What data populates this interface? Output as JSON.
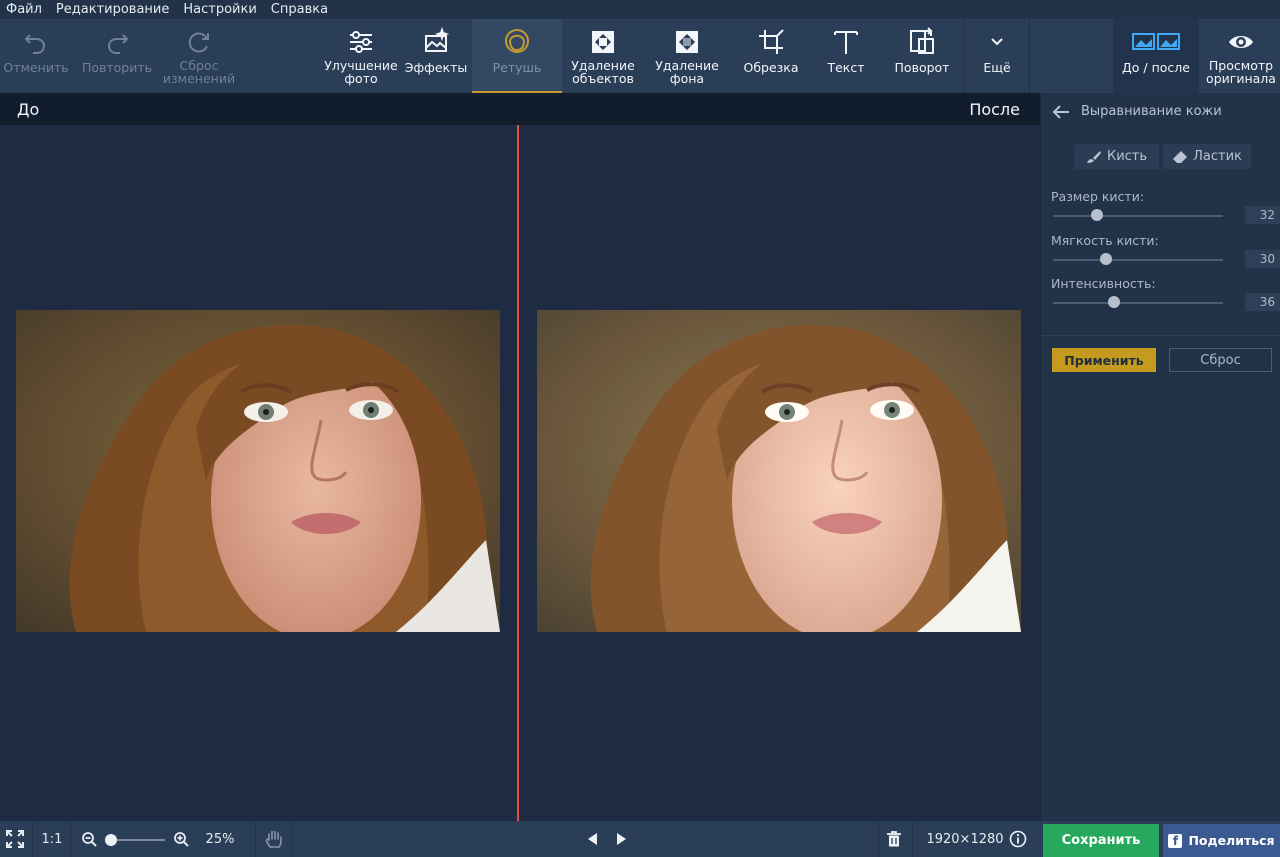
{
  "menu": [
    "Файл",
    "Редактирование",
    "Настройки",
    "Справка"
  ],
  "toolbar": {
    "undo": "Отменить",
    "redo": "Повторить",
    "reset_l1": "Сброс",
    "reset_l2": "изменений",
    "enhance_l1": "Улучшение",
    "enhance_l2": "фото",
    "effects": "Эффекты",
    "retouch": "Ретушь",
    "remove_obj_l1": "Удаление",
    "remove_obj_l2": "объектов",
    "remove_bg_l1": "Удаление",
    "remove_bg_l2": "фона",
    "crop": "Обрезка",
    "text": "Текст",
    "rotate": "Поворот",
    "more": "Ещё",
    "before_after": "До / после",
    "preview_l1": "Просмотр",
    "preview_l2": "оригинала"
  },
  "compare": {
    "before": "До",
    "after": "После"
  },
  "panel": {
    "title": "Выравнивание кожи",
    "brush": "Кисть",
    "eraser": "Ластик",
    "sliders": [
      {
        "label": "Размер кисти:",
        "value": "32",
        "level": 0.26
      },
      {
        "label": "Мягкость кисти:",
        "value": "30",
        "level": 0.31
      },
      {
        "label": "Интенсивность:",
        "value": "36",
        "level": 0.36
      }
    ],
    "apply": "Применить",
    "reset": "Сброс"
  },
  "statusbar": {
    "ratio": "1:1",
    "zoom": "25%",
    "dimensions": "1920×1280",
    "save": "Сохранить",
    "share": "Поделиться"
  },
  "colors": {
    "accent_active": "#c49a33",
    "divider": "#e0553a",
    "save": "#27a95d",
    "share": "#3c5a92"
  }
}
